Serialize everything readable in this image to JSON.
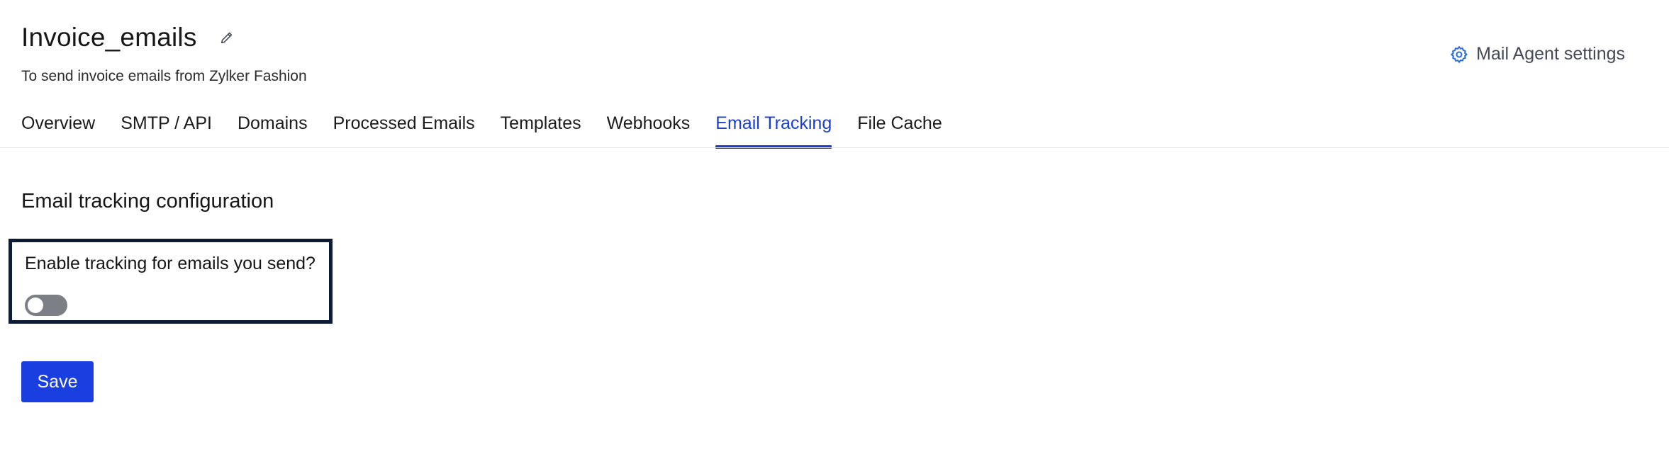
{
  "header": {
    "title": "Invoice_emails",
    "subtitle": "To send invoice emails from Zylker Fashion",
    "edit_icon": "pencil-icon",
    "settings_label": "Mail Agent settings",
    "settings_icon": "gear-icon"
  },
  "tabs": [
    {
      "label": "Overview",
      "active": false
    },
    {
      "label": "SMTP / API",
      "active": false
    },
    {
      "label": "Domains",
      "active": false
    },
    {
      "label": "Processed Emails",
      "active": false
    },
    {
      "label": "Templates",
      "active": false
    },
    {
      "label": "Webhooks",
      "active": false
    },
    {
      "label": "Email Tracking",
      "active": true
    },
    {
      "label": "File Cache",
      "active": false
    }
  ],
  "main": {
    "section_title": "Email tracking configuration",
    "tracking_question": "Enable tracking for emails you send?",
    "tracking_enabled": false,
    "save_label": "Save"
  },
  "colors": {
    "accent": "#1a3fd0",
    "button": "#1a3fe0",
    "toggle_off": "#7c7f86",
    "highlight_border": "#0d1b35"
  }
}
